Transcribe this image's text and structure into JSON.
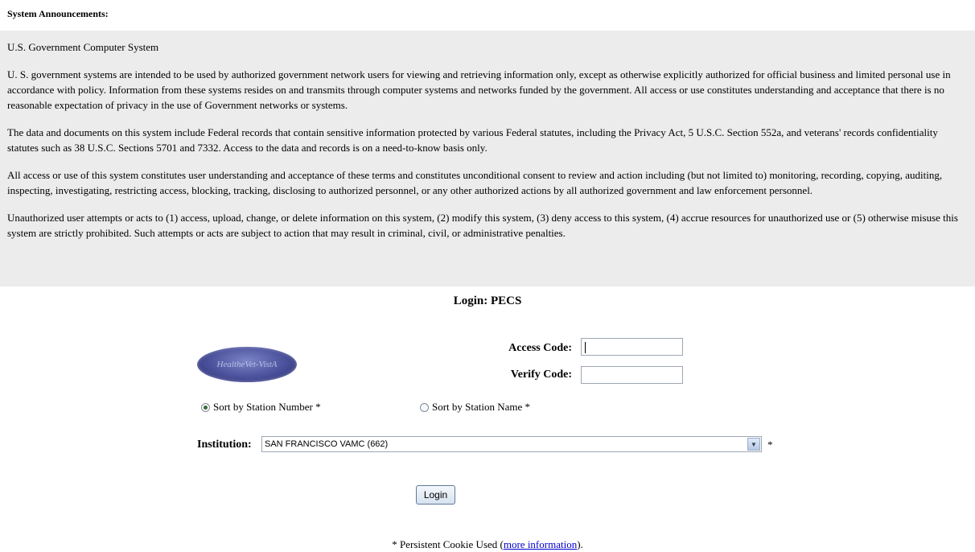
{
  "announcements": {
    "heading": "System Announcements:",
    "paragraphs": [
      "U.S. Government Computer System",
      "U. S. government systems are intended to be used by authorized government network users for viewing and retrieving information only, except as otherwise explicitly authorized for official business and limited personal use in accordance with policy. Information from these systems resides on and transmits through computer systems and networks funded by the government. All access or use constitutes understanding and acceptance that there is no reasonable expectation of privacy in the use of Government networks or systems.",
      "The data and documents on this system include Federal records that contain sensitive information protected by various Federal statutes, including the Privacy Act, 5 U.S.C. Section 552a, and veterans' records confidentiality statutes such as 38 U.S.C. Sections 5701 and 7332. Access to the data and records is on a need-to-know basis only.",
      "All access or use of this system constitutes user understanding and acceptance of these terms and constitutes unconditional consent to review and action including (but not limited to) monitoring, recording, copying, auditing, inspecting, investigating, restricting access, blocking, tracking, disclosing to authorized personnel, or any other authorized actions by all authorized government and law enforcement personnel.",
      "Unauthorized user attempts or acts to (1) access, upload, change, or delete information on this system, (2) modify this system, (3) deny access to this system, (4) accrue resources for unauthorized use or (5) otherwise misuse this system are strictly prohibited. Such attempts or acts are subject to action that may result in criminal, civil, or administrative penalties."
    ]
  },
  "login": {
    "title": "Login: PECS",
    "logo_text": "HealtheVet-VistA",
    "access_code_label": "Access Code:",
    "access_code_value": "",
    "verify_code_label": "Verify Code:",
    "verify_code_value": "",
    "sort_by_number_label": "Sort by Station Number *",
    "sort_by_number_checked": true,
    "sort_by_name_label": "Sort by Station Name *",
    "sort_by_name_checked": false,
    "institution_label": "Institution:",
    "institution_selected": "SAN FRANCISCO VAMC (662)",
    "institution_required_mark": "*",
    "login_button": "Login"
  },
  "footer": {
    "prefix": "* Persistent Cookie Used (",
    "link_text": "more information",
    "suffix": ")."
  },
  "colors": {
    "announcement_bg": "#ececec",
    "link": "#0000cc"
  }
}
